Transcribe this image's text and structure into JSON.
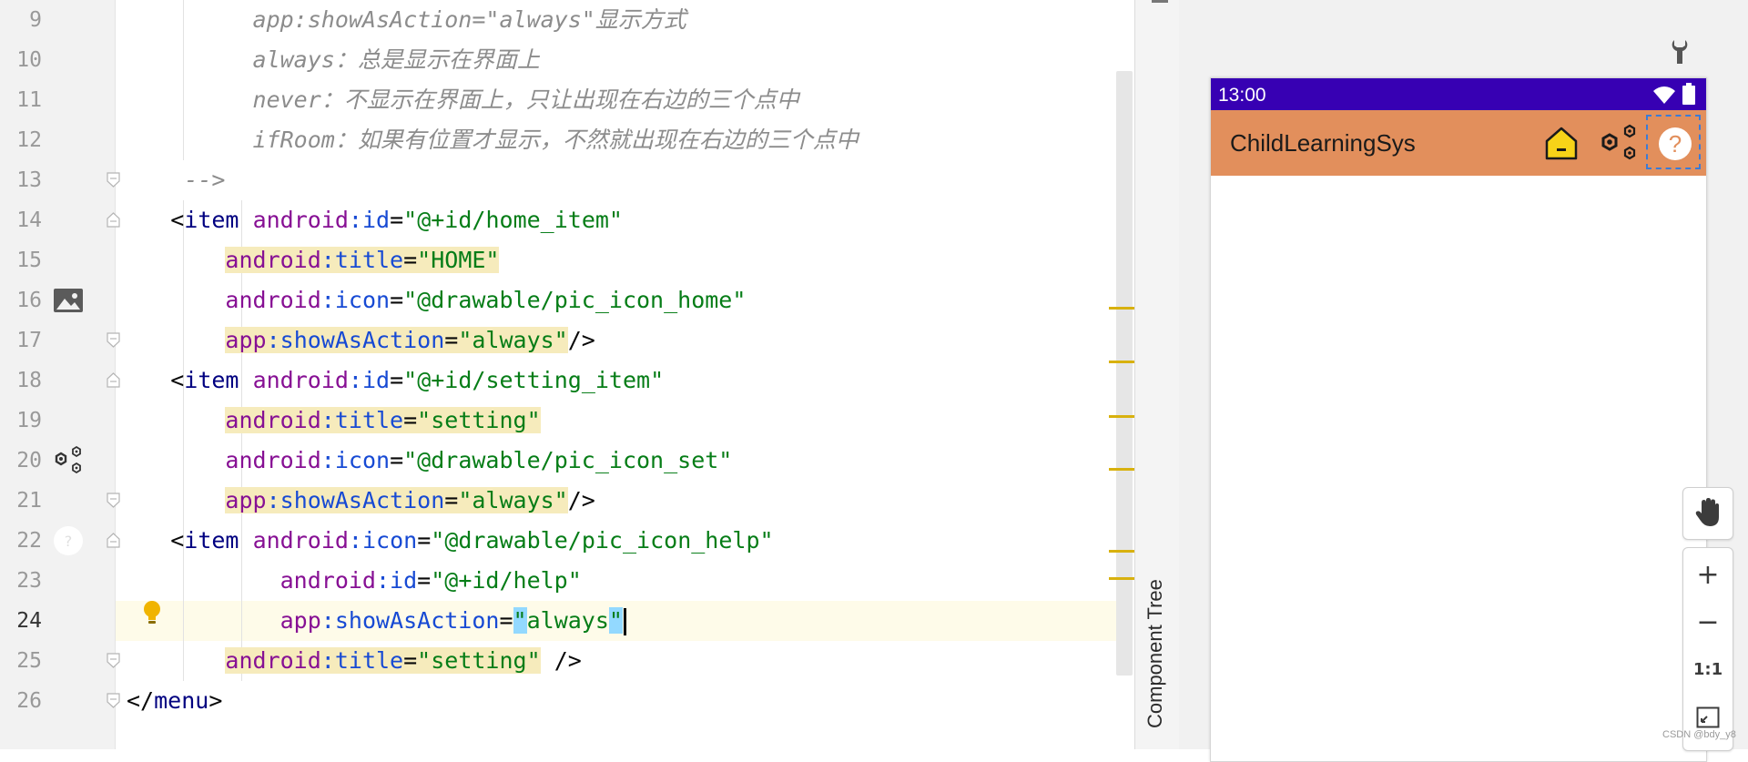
{
  "editor": {
    "line_numbers": [
      "9",
      "10",
      "11",
      "12",
      "13",
      "14",
      "15",
      "16",
      "17",
      "18",
      "19",
      "20",
      "21",
      "22",
      "23",
      "24",
      "25",
      "26"
    ],
    "lines": {
      "l9": {
        "comment": "app:showAsAction=\"always\"显示方式"
      },
      "l10": {
        "comment": "always：总是显示在界面上"
      },
      "l11": {
        "comment": "never：不显示在界面上，只让出现在右边的三个点中"
      },
      "l12": {
        "comment": "ifRoom：如果有位置才显示，不然就出现在右边的三个点中"
      },
      "l13": {
        "comment": "-->"
      },
      "l14": {
        "open": "<",
        "tag": "item",
        "ns": "android",
        "colon": ":",
        "attr": "id",
        "eq": "=",
        "value": "\"@+id/home_item\""
      },
      "l15": {
        "ns": "android",
        "colon": ":",
        "attr": "title",
        "eq": "=",
        "value": "\"HOME\""
      },
      "l16": {
        "ns": "android",
        "colon": ":",
        "attr": "icon",
        "eq": "=",
        "value": "\"@drawable/pic_icon_home\""
      },
      "l17": {
        "ns": "app",
        "colon": ":",
        "attr": "showAsAction",
        "eq": "=",
        "value": "\"always\"",
        "close": "/>"
      },
      "l18": {
        "open": "<",
        "tag": "item",
        "ns": "android",
        "colon": ":",
        "attr": "id",
        "eq": "=",
        "value": "\"@+id/setting_item\""
      },
      "l19": {
        "ns": "android",
        "colon": ":",
        "attr": "title",
        "eq": "=",
        "value": "\"setting\""
      },
      "l20": {
        "ns": "android",
        "colon": ":",
        "attr": "icon",
        "eq": "=",
        "value": "\"@drawable/pic_icon_set\""
      },
      "l21": {
        "ns": "app",
        "colon": ":",
        "attr": "showAsAction",
        "eq": "=",
        "value": "\"always\"",
        "close": "/>"
      },
      "l22": {
        "open": "<",
        "tag": "item",
        "ns": "android",
        "colon": ":",
        "attr": "icon",
        "eq": "=",
        "value": "\"@drawable/pic_icon_help\""
      },
      "l23": {
        "ns": "android",
        "colon": ":",
        "attr": "id",
        "eq": "=",
        "value": "\"@+id/help\""
      },
      "l24": {
        "ns": "app",
        "colon": ":",
        "attr": "showAsAction",
        "eq": "=",
        "q1": "\"",
        "value": "always",
        "q2": "\""
      },
      "l25": {
        "ns": "android",
        "colon": ":",
        "attr": "title",
        "eq": "=",
        "value": "\"setting\"",
        "close": " />"
      },
      "l26": {
        "open": "</",
        "tag": "menu",
        "close": ">"
      }
    }
  },
  "side_panel": {
    "component_tree_label": "Component Tree"
  },
  "preview": {
    "status_bar": {
      "time": "13:00",
      "color": "#3700b3"
    },
    "app_bar": {
      "title": "ChildLearningSys",
      "color": "#e28f5c"
    },
    "actions": {
      "home_icon": "home-icon",
      "settings_icon": "settings-icon",
      "help_glyph": "?"
    },
    "zoom_controls": {
      "zoom_in": "+",
      "zoom_out": "−",
      "actual_size": "1:1"
    },
    "watermark": "CSDN @bdy_y8"
  }
}
